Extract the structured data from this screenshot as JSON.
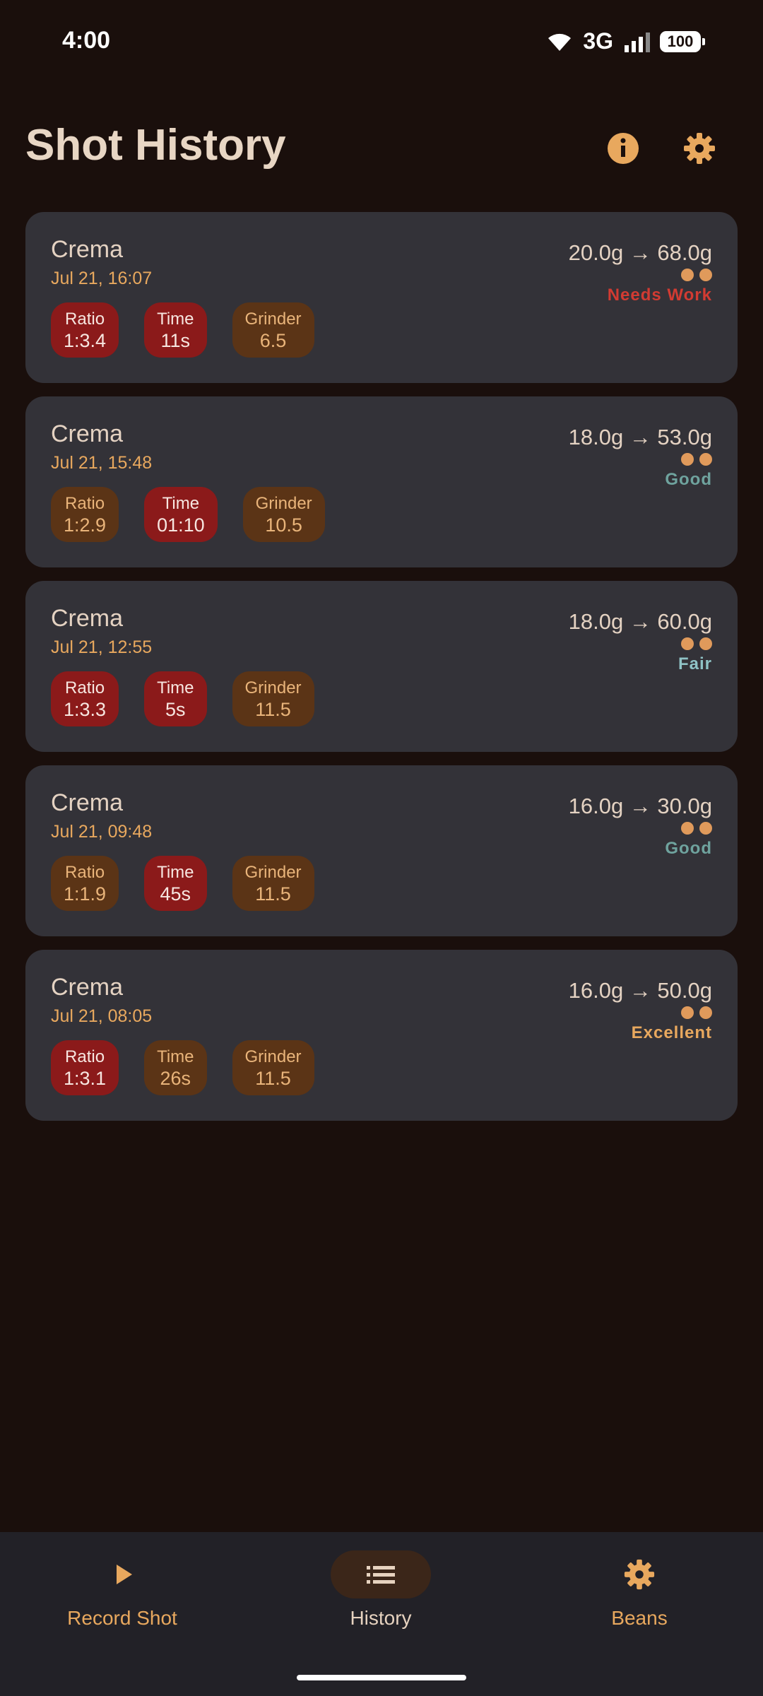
{
  "status_bar": {
    "time": "4:00",
    "network": "3G",
    "battery": "100"
  },
  "header": {
    "title": "Shot History",
    "info_icon": "info-icon",
    "settings_icon": "gear-icon"
  },
  "shots": [
    {
      "bean": "Crema",
      "date": "Jul 21, 16:07",
      "weights": "20.0g → 68.0g",
      "rating": "Needs Work",
      "rating_color": "#d23b32",
      "chips": [
        {
          "label": "Ratio",
          "value": "1:3.4",
          "style": "red"
        },
        {
          "label": "Time",
          "value": "11s",
          "style": "red"
        },
        {
          "label": "Grinder",
          "value": "6.5",
          "style": "brown"
        }
      ]
    },
    {
      "bean": "Crema",
      "date": "Jul 21, 15:48",
      "weights": "18.0g → 53.0g",
      "rating": "Good",
      "rating_color": "#6fa39e",
      "chips": [
        {
          "label": "Ratio",
          "value": "1:2.9",
          "style": "brown"
        },
        {
          "label": "Time",
          "value": "01:10",
          "style": "red"
        },
        {
          "label": "Grinder",
          "value": "10.5",
          "style": "brown"
        }
      ]
    },
    {
      "bean": "Crema",
      "date": "Jul 21, 12:55",
      "weights": "18.0g → 60.0g",
      "rating": "Fair",
      "rating_color": "#8fc3c6",
      "chips": [
        {
          "label": "Ratio",
          "value": "1:3.3",
          "style": "red"
        },
        {
          "label": "Time",
          "value": "5s",
          "style": "red"
        },
        {
          "label": "Grinder",
          "value": "11.5",
          "style": "brown"
        }
      ]
    },
    {
      "bean": "Crema",
      "date": "Jul 21, 09:48",
      "weights": "16.0g → 30.0g",
      "rating": "Good",
      "rating_color": "#6fa39e",
      "chips": [
        {
          "label": "Ratio",
          "value": "1:1.9",
          "style": "brown"
        },
        {
          "label": "Time",
          "value": "45s",
          "style": "red"
        },
        {
          "label": "Grinder",
          "value": "11.5",
          "style": "brown"
        }
      ]
    },
    {
      "bean": "Crema",
      "date": "Jul 21, 08:05",
      "weights": "16.0g → 50.0g",
      "rating": "Excellent",
      "rating_color": "#e8a85e",
      "chips": [
        {
          "label": "Ratio",
          "value": "1:3.1",
          "style": "red"
        },
        {
          "label": "Time",
          "value": "26s",
          "style": "brown"
        },
        {
          "label": "Grinder",
          "value": "11.5",
          "style": "brown"
        }
      ]
    }
  ],
  "nav": {
    "items": [
      {
        "label": "Record Shot",
        "icon": "play-icon",
        "active": false
      },
      {
        "label": "History",
        "icon": "list-icon",
        "active": true
      },
      {
        "label": "Beans",
        "icon": "gear-icon",
        "active": false
      }
    ]
  },
  "colors": {
    "accent": "#e8a85e",
    "background": "#1a0f0c",
    "card": "#333238"
  }
}
